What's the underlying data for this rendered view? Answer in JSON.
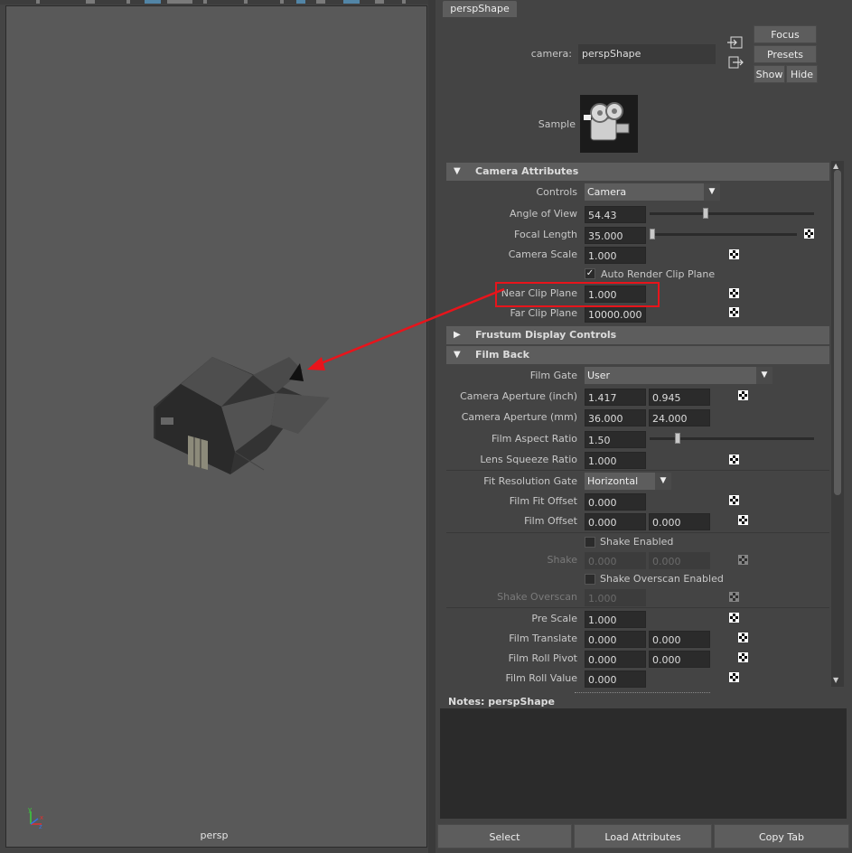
{
  "viewport": {
    "label": "persp",
    "axis_labels": {
      "y": "y",
      "x": "x",
      "z": "z"
    }
  },
  "tab": {
    "label": "perspShape"
  },
  "header": {
    "camera_label": "camera:",
    "camera_value": "perspShape",
    "focus_label": "Focus",
    "presets_label": "Presets",
    "show_label": "Show",
    "hide_label": "Hide",
    "sample_label": "Sample"
  },
  "sections": {
    "camera_attributes": "Camera Attributes",
    "frustum_display_controls": "Frustum Display Controls",
    "film_back": "Film Back"
  },
  "camera": {
    "controls_label": "Controls",
    "controls_value": "Camera",
    "angle_of_view_label": "Angle of View",
    "angle_of_view_value": "54.43",
    "angle_of_view_slider_fraction": 0.34,
    "focal_length_label": "Focal Length",
    "focal_length_value": "35.000",
    "focal_length_slider_fraction": 0.02,
    "camera_scale_label": "Camera Scale",
    "camera_scale_value": "1.000",
    "auto_render_clip_label": "Auto Render Clip Plane",
    "auto_render_clip_checked": true,
    "near_clip_label": "Near Clip Plane",
    "near_clip_value": "1.000",
    "far_clip_label": "Far Clip Plane",
    "far_clip_value": "10000.000"
  },
  "film_back": {
    "film_gate_label": "Film Gate",
    "film_gate_value": "User",
    "aperture_inch_label": "Camera Aperture (inch)",
    "aperture_inch_1": "1.417",
    "aperture_inch_2": "0.945",
    "aperture_mm_label": "Camera Aperture (mm)",
    "aperture_mm_1": "36.000",
    "aperture_mm_2": "24.000",
    "film_aspect_label": "Film Aspect Ratio",
    "film_aspect_value": "1.50",
    "film_aspect_slider_fraction": 0.17,
    "lens_squeeze_label": "Lens Squeeze Ratio",
    "lens_squeeze_value": "1.000",
    "fit_res_gate_label": "Fit Resolution Gate",
    "fit_res_gate_value": "Horizontal",
    "film_fit_offset_label": "Film Fit Offset",
    "film_fit_offset_value": "0.000",
    "film_offset_label": "Film Offset",
    "film_offset_1": "0.000",
    "film_offset_2": "0.000",
    "shake_enabled_label": "Shake Enabled",
    "shake_label": "Shake",
    "shake_1": "0.000",
    "shake_2": "0.000",
    "shake_overscan_enabled_label": "Shake Overscan Enabled",
    "shake_overscan_label": "Shake Overscan",
    "shake_overscan_value": "1.000",
    "pre_scale_label": "Pre Scale",
    "pre_scale_value": "1.000",
    "film_translate_label": "Film Translate",
    "film_translate_1": "0.000",
    "film_translate_2": "0.000",
    "film_roll_pivot_label": "Film Roll Pivot",
    "film_roll_pivot_1": "0.000",
    "film_roll_pivot_2": "0.000",
    "film_roll_value_label": "Film Roll Value",
    "film_roll_value_value": "0.000"
  },
  "notes": {
    "label": "Notes:  perspShape"
  },
  "bottom": {
    "select_label": "Select",
    "load_attributes_label": "Load Attributes",
    "copy_tab_label": "Copy Tab"
  },
  "colors": {
    "annotation_red": "#e8141b",
    "panel_bg": "#444444",
    "field_bg": "#2b2b2b",
    "header_bg": "#5d5d5d"
  }
}
